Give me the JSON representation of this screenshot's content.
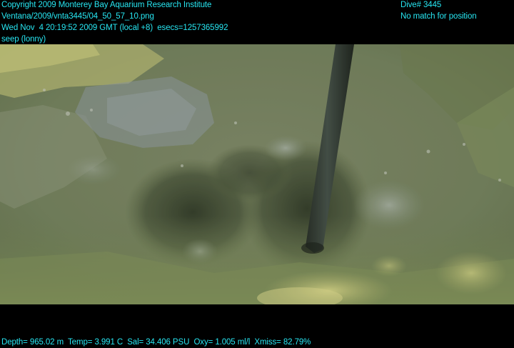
{
  "header_left": {
    "line1": "Copyright 2009 Monterey Bay Aquarium Research Institute",
    "line2": "Ventana/2009/vnta3445/04_50_57_10.png",
    "line3": "Wed Nov  4 20:19:52 2009 GMT (local +8)  esecs=1257365992",
    "line4": "seep (lonny)"
  },
  "header_right": {
    "line1": "Dive# 3445",
    "line2": "No match for position"
  },
  "footer": {
    "telemetry": "Depth= 965.02 m  Temp= 3.991 C  Sal= 34.406 PSU  Oxy= 1.005 ml/l  Xmiss= 82.79%"
  },
  "colors": {
    "overlay_text": "#27e6f2",
    "frame_background": "#000000",
    "water_tint": "#7d8a63",
    "bacterial_mat": "#c8c878"
  }
}
